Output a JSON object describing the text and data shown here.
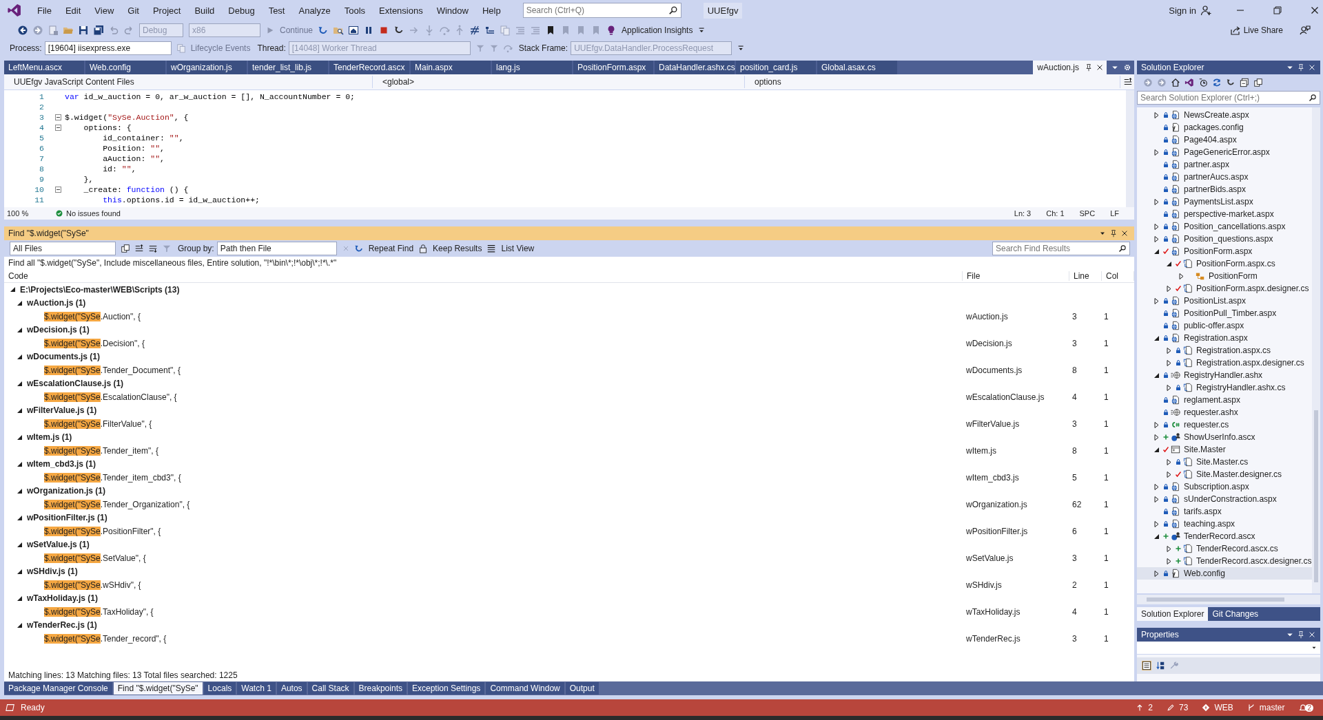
{
  "menu": [
    "File",
    "Edit",
    "View",
    "Git",
    "Project",
    "Build",
    "Debug",
    "Test",
    "Analyze",
    "Tools",
    "Extensions",
    "Window",
    "Help"
  ],
  "search": {
    "placeholder": "Search (Ctrl+Q)"
  },
  "solution_name": "UUEfgv",
  "account": {
    "label": "Sign in"
  },
  "toolbar": {
    "configuration": "Debug",
    "platform": "x86",
    "continue": "Continue",
    "insights": "Application Insights",
    "live_share": "Live Share"
  },
  "debug_bar": {
    "process_label": "Process:",
    "process": "[19604] iisexpress.exe",
    "lifecycle": "Lifecycle Events",
    "thread_label": "Thread:",
    "thread": "[14048] Worker Thread",
    "stack_label": "Stack Frame:",
    "stack": "UUEfgv.DataHandler.ProcessRequest"
  },
  "editor_tabs": [
    {
      "label": "LeftMenu.ascx",
      "selected": false
    },
    {
      "label": "Web.config",
      "selected": false
    },
    {
      "label": "wOrganization.js",
      "selected": false
    },
    {
      "label": "tender_list_lib.js",
      "selected": false
    },
    {
      "label": "TenderRecord.ascx",
      "selected": false
    },
    {
      "label": "Main.aspx",
      "selected": false
    },
    {
      "label": "lang.js",
      "selected": false
    },
    {
      "label": "PositionForm.aspx",
      "selected": false
    },
    {
      "label": "DataHandler.ashx.cs",
      "selected": false
    },
    {
      "label": "position_card.js",
      "selected": false
    },
    {
      "label": "Global.asax.cs",
      "selected": false
    },
    {
      "label": "wAuction.js",
      "selected": true
    }
  ],
  "navigation": {
    "project": "UUEfgv JavaScript Content Files",
    "scope": "<global>",
    "member": "options"
  },
  "code": [
    {
      "n": "1",
      "tokens": [
        {
          "kind": "keyword",
          "t": "var"
        },
        {
          "kind": "plain",
          "t": " id_w_auction = 0, ar_w_auction = [], N_accountNumber = 0;"
        }
      ]
    },
    {
      "n": "2"
    },
    {
      "n": "3",
      "fold": true,
      "tokens": [
        {
          "kind": "plain",
          "t": "$.widget("
        },
        {
          "kind": "string",
          "t": "\"SySe.Auction\""
        },
        {
          "kind": "plain",
          "t": ", {"
        }
      ]
    },
    {
      "n": "4",
      "fold": true,
      "tokens": [
        {
          "kind": "plain",
          "t": "    options: {"
        }
      ]
    },
    {
      "n": "5",
      "tokens": [
        {
          "kind": "plain",
          "t": "        id_container: "
        },
        {
          "kind": "string",
          "t": "\"\""
        },
        {
          "kind": "plain",
          "t": ","
        }
      ]
    },
    {
      "n": "6",
      "tokens": [
        {
          "kind": "plain",
          "t": "        Position: "
        },
        {
          "kind": "string",
          "t": "\"\""
        },
        {
          "kind": "plain",
          "t": ","
        }
      ]
    },
    {
      "n": "7",
      "tokens": [
        {
          "kind": "plain",
          "t": "        aAuction: "
        },
        {
          "kind": "string",
          "t": "\"\""
        },
        {
          "kind": "plain",
          "t": ","
        }
      ]
    },
    {
      "n": "8",
      "tokens": [
        {
          "kind": "plain",
          "t": "        id: "
        },
        {
          "kind": "string",
          "t": "\"\""
        },
        {
          "kind": "plain",
          "t": ","
        }
      ]
    },
    {
      "n": "9",
      "tokens": [
        {
          "kind": "plain",
          "t": "    },"
        }
      ]
    },
    {
      "n": "10",
      "fold": true,
      "tokens": [
        {
          "kind": "plain",
          "t": "    _create: "
        },
        {
          "kind": "keyword",
          "t": "function"
        },
        {
          "kind": "plain",
          "t": " () {"
        }
      ]
    },
    {
      "n": "11",
      "tokens": [
        {
          "kind": "keyword",
          "t": "        this"
        },
        {
          "kind": "plain",
          "t": ".options.id = id_w_auction++;"
        }
      ]
    }
  ],
  "editor_status": {
    "zoom": "100 %",
    "issues": "No issues found",
    "line": "Ln: 3",
    "char": "Ch: 1",
    "spacing": "SPC",
    "ending": "LF"
  },
  "find": {
    "title": "Find \"$.widget(\"SySe\"",
    "scope": "All Files",
    "group_label": "Group by:",
    "group": "Path then File",
    "repeat": "Repeat Find",
    "keep": "Keep Results",
    "list_view": "List View",
    "search_placeholder": "Search Find Results",
    "description": "Find all \"$.widget(\"SySe\", Include miscellaneous files, Entire solution, \"!*\\bin\\*;!*\\obj\\*;!*\\.*\"",
    "columns": [
      "Code",
      "File",
      "Line",
      "Col"
    ],
    "root": {
      "path": "E:\\Projects\\Eco-master\\WEB\\Scripts",
      "count": "(13)",
      "expanded": true
    },
    "results": [
      {
        "name": "wAuction.js",
        "count": "(1)",
        "expanded": true,
        "match": "$.widget(\"SySe",
        "rest": ".Auction\", {",
        "file": "wAuction.js",
        "line": "3",
        "col": "1"
      },
      {
        "name": "wDecision.js",
        "count": "(1)",
        "expanded": true,
        "match": "$.widget(\"SySe",
        "rest": ".Decision\", {",
        "file": "wDecision.js",
        "line": "3",
        "col": "1"
      },
      {
        "name": "wDocuments.js",
        "count": "(1)",
        "expanded": true,
        "match": "$.widget(\"SySe",
        "rest": ".Tender_Document\", {",
        "file": "wDocuments.js",
        "line": "8",
        "col": "1"
      },
      {
        "name": "wEscalationClause.js",
        "count": "(1)",
        "expanded": true,
        "match": "$.widget(\"SySe",
        "rest": ".EscalationClause\", {",
        "file": "wEscalationClause.js",
        "line": "4",
        "col": "1"
      },
      {
        "name": "wFilterValue.js",
        "count": "(1)",
        "expanded": true,
        "match": "$.widget(\"SySe",
        "rest": ".FilterValue\", {",
        "file": "wFilterValue.js",
        "line": "3",
        "col": "1"
      },
      {
        "name": "wItem.js",
        "count": "(1)",
        "expanded": true,
        "match": "$.widget(\"SySe",
        "rest": ".Tender_item\", {",
        "file": "wItem.js",
        "line": "8",
        "col": "1"
      },
      {
        "name": "wItem_cbd3.js",
        "count": "(1)",
        "expanded": true,
        "match": "$.widget(\"SySe",
        "rest": ".Tender_item_cbd3\", {",
        "file": "wItem_cbd3.js",
        "line": "5",
        "col": "1"
      },
      {
        "name": "wOrganization.js",
        "count": "(1)",
        "expanded": true,
        "match": "$.widget(\"SySe",
        "rest": ".Tender_Organization\", {",
        "file": "wOrganization.js",
        "line": "62",
        "col": "1"
      },
      {
        "name": "wPositionFilter.js",
        "count": "(1)",
        "expanded": true,
        "match": "$.widget(\"SySe",
        "rest": ".PositionFilter\", {",
        "file": "wPositionFilter.js",
        "line": "6",
        "col": "1"
      },
      {
        "name": "wSetValue.js",
        "count": "(1)",
        "expanded": true,
        "match": "$.widget(\"SySe",
        "rest": ".SetValue\", {",
        "file": "wSetValue.js",
        "line": "3",
        "col": "1"
      },
      {
        "name": "wSHdiv.js",
        "count": "(1)",
        "expanded": true,
        "match": "$.widget(\"SySe",
        "rest": ".wSHdiv\", {",
        "file": "wSHdiv.js",
        "line": "2",
        "col": "1"
      },
      {
        "name": "wTaxHoliday.js",
        "count": "(1)",
        "expanded": true,
        "match": "$.widget(\"SySe",
        "rest": ".TaxHoliday\", {",
        "file": "wTaxHoliday.js",
        "line": "4",
        "col": "1"
      },
      {
        "name": "wTenderRec.js",
        "count": "(1)",
        "expanded": true,
        "match": "$.widget(\"SySe",
        "rest": ".Tender_record\", {",
        "file": "wTenderRec.js",
        "line": "3",
        "col": "1"
      }
    ],
    "summary": "Matching lines: 13 Matching files: 13 Total files searched: 1225"
  },
  "solution": {
    "title": "Solution Explorer",
    "search_placeholder": "Search Solution Explorer (Ctrl+;)",
    "items": [
      {
        "label": "NewsCreate.aspx",
        "expandable": true,
        "expanded": false,
        "locked": true,
        "modified": false,
        "added": false,
        "kind": "page",
        "selected": false
      },
      {
        "label": "packages.config",
        "expandable": false,
        "expanded": false,
        "locked": true,
        "modified": false,
        "added": false,
        "kind": "config",
        "selected": false
      },
      {
        "label": "Page404.aspx",
        "expandable": false,
        "expanded": false,
        "locked": true,
        "modified": false,
        "added": false,
        "kind": "page",
        "selected": false
      },
      {
        "label": "PageGenericError.aspx",
        "expandable": true,
        "expanded": false,
        "locked": true,
        "modified": false,
        "added": false,
        "kind": "page",
        "selected": false
      },
      {
        "label": "partner.aspx",
        "expandable": false,
        "expanded": false,
        "locked": true,
        "modified": false,
        "added": false,
        "kind": "page",
        "selected": false
      },
      {
        "label": "partnerAucs.aspx",
        "expandable": false,
        "expanded": false,
        "locked": true,
        "modified": false,
        "added": false,
        "kind": "page",
        "selected": false
      },
      {
        "label": "partnerBids.aspx",
        "expandable": false,
        "expanded": false,
        "locked": true,
        "modified": false,
        "added": false,
        "kind": "page",
        "selected": false
      },
      {
        "label": "PaymentsList.aspx",
        "expandable": true,
        "expanded": false,
        "locked": true,
        "modified": false,
        "added": false,
        "kind": "page",
        "selected": false
      },
      {
        "label": "perspective-market.aspx",
        "expandable": false,
        "expanded": false,
        "locked": true,
        "modified": false,
        "added": false,
        "kind": "page",
        "selected": false
      },
      {
        "label": "Position_cancellations.aspx",
        "expandable": true,
        "expanded": false,
        "locked": true,
        "modified": false,
        "added": false,
        "kind": "page",
        "selected": false
      },
      {
        "label": "Position_questions.aspx",
        "expandable": true,
        "expanded": false,
        "locked": true,
        "modified": false,
        "added": false,
        "kind": "page",
        "selected": false
      },
      {
        "label": "PositionForm.aspx",
        "expandable": true,
        "expanded": true,
        "locked": false,
        "modified": true,
        "added": false,
        "kind": "page",
        "selected": false,
        "children": [
          {
            "label": "PositionForm.aspx.cs",
            "expandable": true,
            "expanded": true,
            "locked": false,
            "modified": true,
            "added": false,
            "kind": "code",
            "selected": false,
            "children": [
              {
                "label": "PositionForm",
                "expandable": true,
                "expanded": false,
                "locked": false,
                "modified": false,
                "added": false,
                "kind": "class",
                "selected": false
              }
            ]
          },
          {
            "label": "PositionForm.aspx.designer.cs",
            "expandable": true,
            "expanded": false,
            "locked": false,
            "modified": true,
            "added": false,
            "kind": "code",
            "selected": false
          }
        ]
      },
      {
        "label": "PositionList.aspx",
        "expandable": true,
        "expanded": false,
        "locked": true,
        "modified": false,
        "added": false,
        "kind": "page",
        "selected": false
      },
      {
        "label": "PositionPull_Timber.aspx",
        "expandable": false,
        "expanded": false,
        "locked": true,
        "modified": false,
        "added": false,
        "kind": "page",
        "selected": false
      },
      {
        "label": "public-offer.aspx",
        "expandable": false,
        "expanded": false,
        "locked": true,
        "modified": false,
        "added": false,
        "kind": "page",
        "selected": false
      },
      {
        "label": "Registration.aspx",
        "expandable": true,
        "expanded": true,
        "locked": true,
        "modified": false,
        "added": false,
        "kind": "page",
        "selected": false,
        "children": [
          {
            "label": "Registration.aspx.cs",
            "expandable": true,
            "expanded": false,
            "locked": true,
            "modified": false,
            "added": false,
            "kind": "code",
            "selected": false
          },
          {
            "label": "Registration.aspx.designer.cs",
            "expandable": true,
            "expanded": false,
            "locked": true,
            "modified": false,
            "added": false,
            "kind": "code",
            "selected": false
          }
        ]
      },
      {
        "label": "RegistryHandler.ashx",
        "expandable": true,
        "expanded": true,
        "locked": true,
        "modified": false,
        "added": false,
        "kind": "handler",
        "selected": false,
        "children": [
          {
            "label": "RegistryHandler.ashx.cs",
            "expandable": true,
            "expanded": false,
            "locked": true,
            "modified": false,
            "added": false,
            "kind": "code",
            "selected": false
          }
        ]
      },
      {
        "label": "reglament.aspx",
        "expandable": false,
        "expanded": false,
        "locked": true,
        "modified": false,
        "added": false,
        "kind": "page",
        "selected": false
      },
      {
        "label": "requester.ashx",
        "expandable": false,
        "expanded": false,
        "locked": true,
        "modified": false,
        "added": false,
        "kind": "handler",
        "selected": false
      },
      {
        "label": "requester.cs",
        "expandable": true,
        "expanded": false,
        "locked": true,
        "modified": false,
        "added": false,
        "kind": "csharp",
        "selected": false
      },
      {
        "label": "ShowUserInfo.ascx",
        "expandable": true,
        "expanded": false,
        "locked": false,
        "modified": false,
        "added": true,
        "kind": "control",
        "selected": false
      },
      {
        "label": "Site.Master",
        "expandable": true,
        "expanded": true,
        "locked": false,
        "modified": true,
        "added": false,
        "kind": "master",
        "selected": false,
        "children": [
          {
            "label": "Site.Master.cs",
            "expandable": true,
            "expanded": false,
            "locked": true,
            "modified": false,
            "added": false,
            "kind": "code",
            "selected": false
          },
          {
            "label": "Site.Master.designer.cs",
            "expandable": true,
            "expanded": false,
            "locked": false,
            "modified": true,
            "added": false,
            "kind": "code",
            "selected": false
          }
        ]
      },
      {
        "label": "Subscription.aspx",
        "expandable": true,
        "expanded": false,
        "locked": true,
        "modified": false,
        "added": false,
        "kind": "page",
        "selected": false
      },
      {
        "label": "sUnderConstraction.aspx",
        "expandable": true,
        "expanded": false,
        "locked": true,
        "modified": false,
        "added": false,
        "kind": "page",
        "selected": false
      },
      {
        "label": "tarifs.aspx",
        "expandable": false,
        "expanded": false,
        "locked": true,
        "modified": false,
        "added": false,
        "kind": "page",
        "selected": false
      },
      {
        "label": "teaching.aspx",
        "expandable": true,
        "expanded": false,
        "locked": true,
        "modified": false,
        "added": false,
        "kind": "page",
        "selected": false
      },
      {
        "label": "TenderRecord.ascx",
        "expandable": true,
        "expanded": true,
        "locked": false,
        "modified": false,
        "added": true,
        "kind": "control",
        "selected": false,
        "children": [
          {
            "label": "TenderRecord.ascx.cs",
            "expandable": true,
            "expanded": false,
            "locked": false,
            "modified": false,
            "added": true,
            "kind": "code",
            "selected": false
          },
          {
            "label": "TenderRecord.ascx.designer.cs",
            "expandable": true,
            "expanded": false,
            "locked": false,
            "modified": false,
            "added": true,
            "kind": "code",
            "selected": false
          }
        ]
      },
      {
        "label": "Web.config",
        "expandable": true,
        "expanded": false,
        "locked": true,
        "modified": false,
        "added": false,
        "kind": "config",
        "selected": true
      }
    ],
    "tabs": [
      {
        "label": "Solution Explorer",
        "selected": true
      },
      {
        "label": "Git Changes",
        "selected": false
      }
    ]
  },
  "properties": {
    "title": "Properties"
  },
  "bottom_tabs": [
    {
      "label": "Package Manager Console",
      "selected": false
    },
    {
      "label": "Find \"$.widget(\"SySe\"",
      "selected": true
    },
    {
      "label": "Locals",
      "selected": false
    },
    {
      "label": "Watch 1",
      "selected": false
    },
    {
      "label": "Autos",
      "selected": false
    },
    {
      "label": "Call Stack",
      "selected": false
    },
    {
      "label": "Breakpoints",
      "selected": false
    },
    {
      "label": "Exception Settings",
      "selected": false
    },
    {
      "label": "Command Window",
      "selected": false
    },
    {
      "label": "Output",
      "selected": false
    }
  ],
  "status_bar": {
    "state": "Ready",
    "commits": "2",
    "changes": "73",
    "repository": "WEB",
    "branch": "master",
    "notifications": "2"
  }
}
